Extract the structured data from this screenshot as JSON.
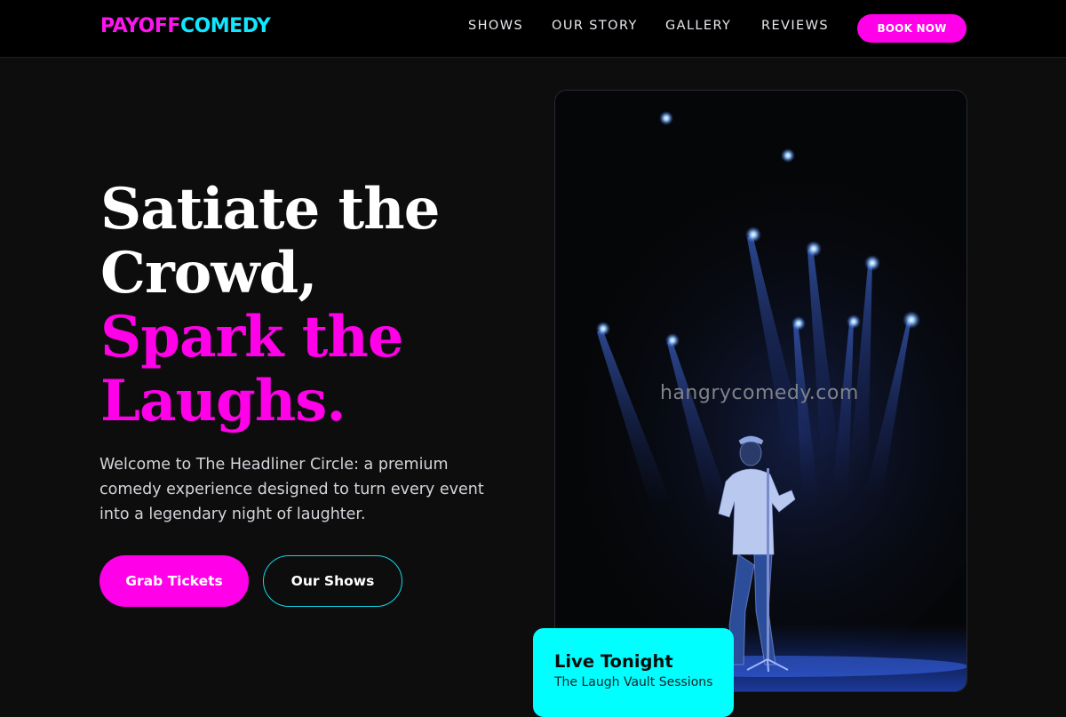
{
  "brand": {
    "part1": "PAYOFF",
    "part2": "COMEDY"
  },
  "nav": {
    "links": [
      "SHOWS",
      "OUR STORY",
      "GALLERY",
      "REVIEWS"
    ],
    "cta": "BOOK NOW"
  },
  "hero": {
    "line1": "Satiate the",
    "line2": "Crowd,",
    "line3": "Spark the",
    "line4": "Laughs.",
    "description": "Welcome to The Headliner Circle: a premium comedy experience designed to turn every event into a legendary night of laughter.",
    "primary_button": "Grab Tickets",
    "secondary_button": "Our Shows"
  },
  "photo": {
    "watermark": "hangrycomedy.com"
  },
  "live_card": {
    "title": "Live Tonight",
    "subtitle": "The Laugh Vault Sessions"
  },
  "colors": {
    "accent_pink": "#ff00e8",
    "accent_cyan": "#00ffff",
    "background": "#0d0d0e"
  }
}
